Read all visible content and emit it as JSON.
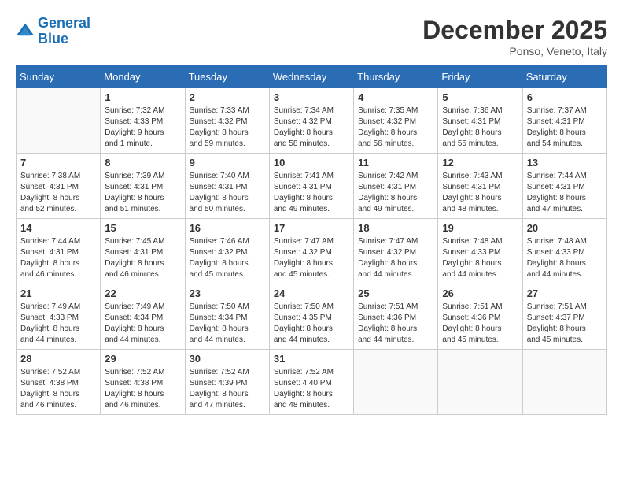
{
  "header": {
    "logo_line1": "General",
    "logo_line2": "Blue",
    "month": "December 2025",
    "location": "Ponso, Veneto, Italy"
  },
  "days_of_week": [
    "Sunday",
    "Monday",
    "Tuesday",
    "Wednesday",
    "Thursday",
    "Friday",
    "Saturday"
  ],
  "weeks": [
    [
      {
        "day": "",
        "detail": ""
      },
      {
        "day": "1",
        "detail": "Sunrise: 7:32 AM\nSunset: 4:33 PM\nDaylight: 9 hours\nand 1 minute."
      },
      {
        "day": "2",
        "detail": "Sunrise: 7:33 AM\nSunset: 4:32 PM\nDaylight: 8 hours\nand 59 minutes."
      },
      {
        "day": "3",
        "detail": "Sunrise: 7:34 AM\nSunset: 4:32 PM\nDaylight: 8 hours\nand 58 minutes."
      },
      {
        "day": "4",
        "detail": "Sunrise: 7:35 AM\nSunset: 4:32 PM\nDaylight: 8 hours\nand 56 minutes."
      },
      {
        "day": "5",
        "detail": "Sunrise: 7:36 AM\nSunset: 4:31 PM\nDaylight: 8 hours\nand 55 minutes."
      },
      {
        "day": "6",
        "detail": "Sunrise: 7:37 AM\nSunset: 4:31 PM\nDaylight: 8 hours\nand 54 minutes."
      }
    ],
    [
      {
        "day": "7",
        "detail": "Sunrise: 7:38 AM\nSunset: 4:31 PM\nDaylight: 8 hours\nand 52 minutes."
      },
      {
        "day": "8",
        "detail": "Sunrise: 7:39 AM\nSunset: 4:31 PM\nDaylight: 8 hours\nand 51 minutes."
      },
      {
        "day": "9",
        "detail": "Sunrise: 7:40 AM\nSunset: 4:31 PM\nDaylight: 8 hours\nand 50 minutes."
      },
      {
        "day": "10",
        "detail": "Sunrise: 7:41 AM\nSunset: 4:31 PM\nDaylight: 8 hours\nand 49 minutes."
      },
      {
        "day": "11",
        "detail": "Sunrise: 7:42 AM\nSunset: 4:31 PM\nDaylight: 8 hours\nand 49 minutes."
      },
      {
        "day": "12",
        "detail": "Sunrise: 7:43 AM\nSunset: 4:31 PM\nDaylight: 8 hours\nand 48 minutes."
      },
      {
        "day": "13",
        "detail": "Sunrise: 7:44 AM\nSunset: 4:31 PM\nDaylight: 8 hours\nand 47 minutes."
      }
    ],
    [
      {
        "day": "14",
        "detail": "Sunrise: 7:44 AM\nSunset: 4:31 PM\nDaylight: 8 hours\nand 46 minutes."
      },
      {
        "day": "15",
        "detail": "Sunrise: 7:45 AM\nSunset: 4:31 PM\nDaylight: 8 hours\nand 46 minutes."
      },
      {
        "day": "16",
        "detail": "Sunrise: 7:46 AM\nSunset: 4:32 PM\nDaylight: 8 hours\nand 45 minutes."
      },
      {
        "day": "17",
        "detail": "Sunrise: 7:47 AM\nSunset: 4:32 PM\nDaylight: 8 hours\nand 45 minutes."
      },
      {
        "day": "18",
        "detail": "Sunrise: 7:47 AM\nSunset: 4:32 PM\nDaylight: 8 hours\nand 44 minutes."
      },
      {
        "day": "19",
        "detail": "Sunrise: 7:48 AM\nSunset: 4:33 PM\nDaylight: 8 hours\nand 44 minutes."
      },
      {
        "day": "20",
        "detail": "Sunrise: 7:48 AM\nSunset: 4:33 PM\nDaylight: 8 hours\nand 44 minutes."
      }
    ],
    [
      {
        "day": "21",
        "detail": "Sunrise: 7:49 AM\nSunset: 4:33 PM\nDaylight: 8 hours\nand 44 minutes."
      },
      {
        "day": "22",
        "detail": "Sunrise: 7:49 AM\nSunset: 4:34 PM\nDaylight: 8 hours\nand 44 minutes."
      },
      {
        "day": "23",
        "detail": "Sunrise: 7:50 AM\nSunset: 4:34 PM\nDaylight: 8 hours\nand 44 minutes."
      },
      {
        "day": "24",
        "detail": "Sunrise: 7:50 AM\nSunset: 4:35 PM\nDaylight: 8 hours\nand 44 minutes."
      },
      {
        "day": "25",
        "detail": "Sunrise: 7:51 AM\nSunset: 4:36 PM\nDaylight: 8 hours\nand 44 minutes."
      },
      {
        "day": "26",
        "detail": "Sunrise: 7:51 AM\nSunset: 4:36 PM\nDaylight: 8 hours\nand 45 minutes."
      },
      {
        "day": "27",
        "detail": "Sunrise: 7:51 AM\nSunset: 4:37 PM\nDaylight: 8 hours\nand 45 minutes."
      }
    ],
    [
      {
        "day": "28",
        "detail": "Sunrise: 7:52 AM\nSunset: 4:38 PM\nDaylight: 8 hours\nand 46 minutes."
      },
      {
        "day": "29",
        "detail": "Sunrise: 7:52 AM\nSunset: 4:38 PM\nDaylight: 8 hours\nand 46 minutes."
      },
      {
        "day": "30",
        "detail": "Sunrise: 7:52 AM\nSunset: 4:39 PM\nDaylight: 8 hours\nand 47 minutes."
      },
      {
        "day": "31",
        "detail": "Sunrise: 7:52 AM\nSunset: 4:40 PM\nDaylight: 8 hours\nand 48 minutes."
      },
      {
        "day": "",
        "detail": ""
      },
      {
        "day": "",
        "detail": ""
      },
      {
        "day": "",
        "detail": ""
      }
    ]
  ]
}
